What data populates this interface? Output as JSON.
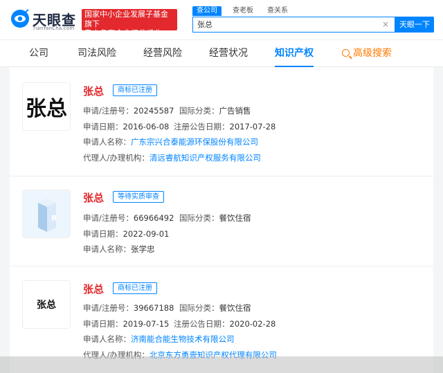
{
  "brand": {
    "name": "天眼查",
    "sub": "TianYanCha.com",
    "slogan_line1": "国家中小企业发展子基金旗下",
    "slogan_line2": "官方备案企业征信机构"
  },
  "search": {
    "tabs": [
      "查公司",
      "查老板",
      "查关系"
    ],
    "value": "张总",
    "button": "天眼一下",
    "clear": "×"
  },
  "nav": {
    "items": [
      "公司",
      "司法风险",
      "经营风险",
      "经营状况",
      "知识产权"
    ],
    "advanced": "高级搜索"
  },
  "labels": {
    "reg_no": "申请/注册号：",
    "intl_class": "国际分类：",
    "apply_date": "申请日期：",
    "announce_date": "注册公告日期：",
    "applicant": "申请人名称：",
    "agent": "代理人/办理机构："
  },
  "cards": [
    {
      "thumb_text": "张总",
      "title": "张总",
      "status": "商标已注册",
      "reg_no": "20245587",
      "intl_class": "广告销售",
      "apply_date": "2016-06-08",
      "announce_date": "2017-07-28",
      "applicant": "广东宗兴合泰能源环保股份有限公司",
      "agent": "清远睿航知识产权服务有限公司"
    },
    {
      "title": "张总",
      "status": "等待实质审查",
      "reg_no": "66966492",
      "intl_class": "餐饮住宿",
      "apply_date": "2022-09-01",
      "applicant": "张学忠"
    },
    {
      "thumb_text": "张总",
      "title": "张总",
      "status": "商标已注册",
      "reg_no": "39667188",
      "intl_class": "餐饮住宿",
      "apply_date": "2019-07-15",
      "announce_date": "2020-02-28",
      "applicant": "济南能合能生物技术有限公司",
      "agent": "北京东方勇壹知识产权代理有限公司"
    }
  ],
  "colors": {
    "accent": "#0084ff",
    "brand_red": "#e3292e",
    "advanced": "#ff7a00"
  }
}
